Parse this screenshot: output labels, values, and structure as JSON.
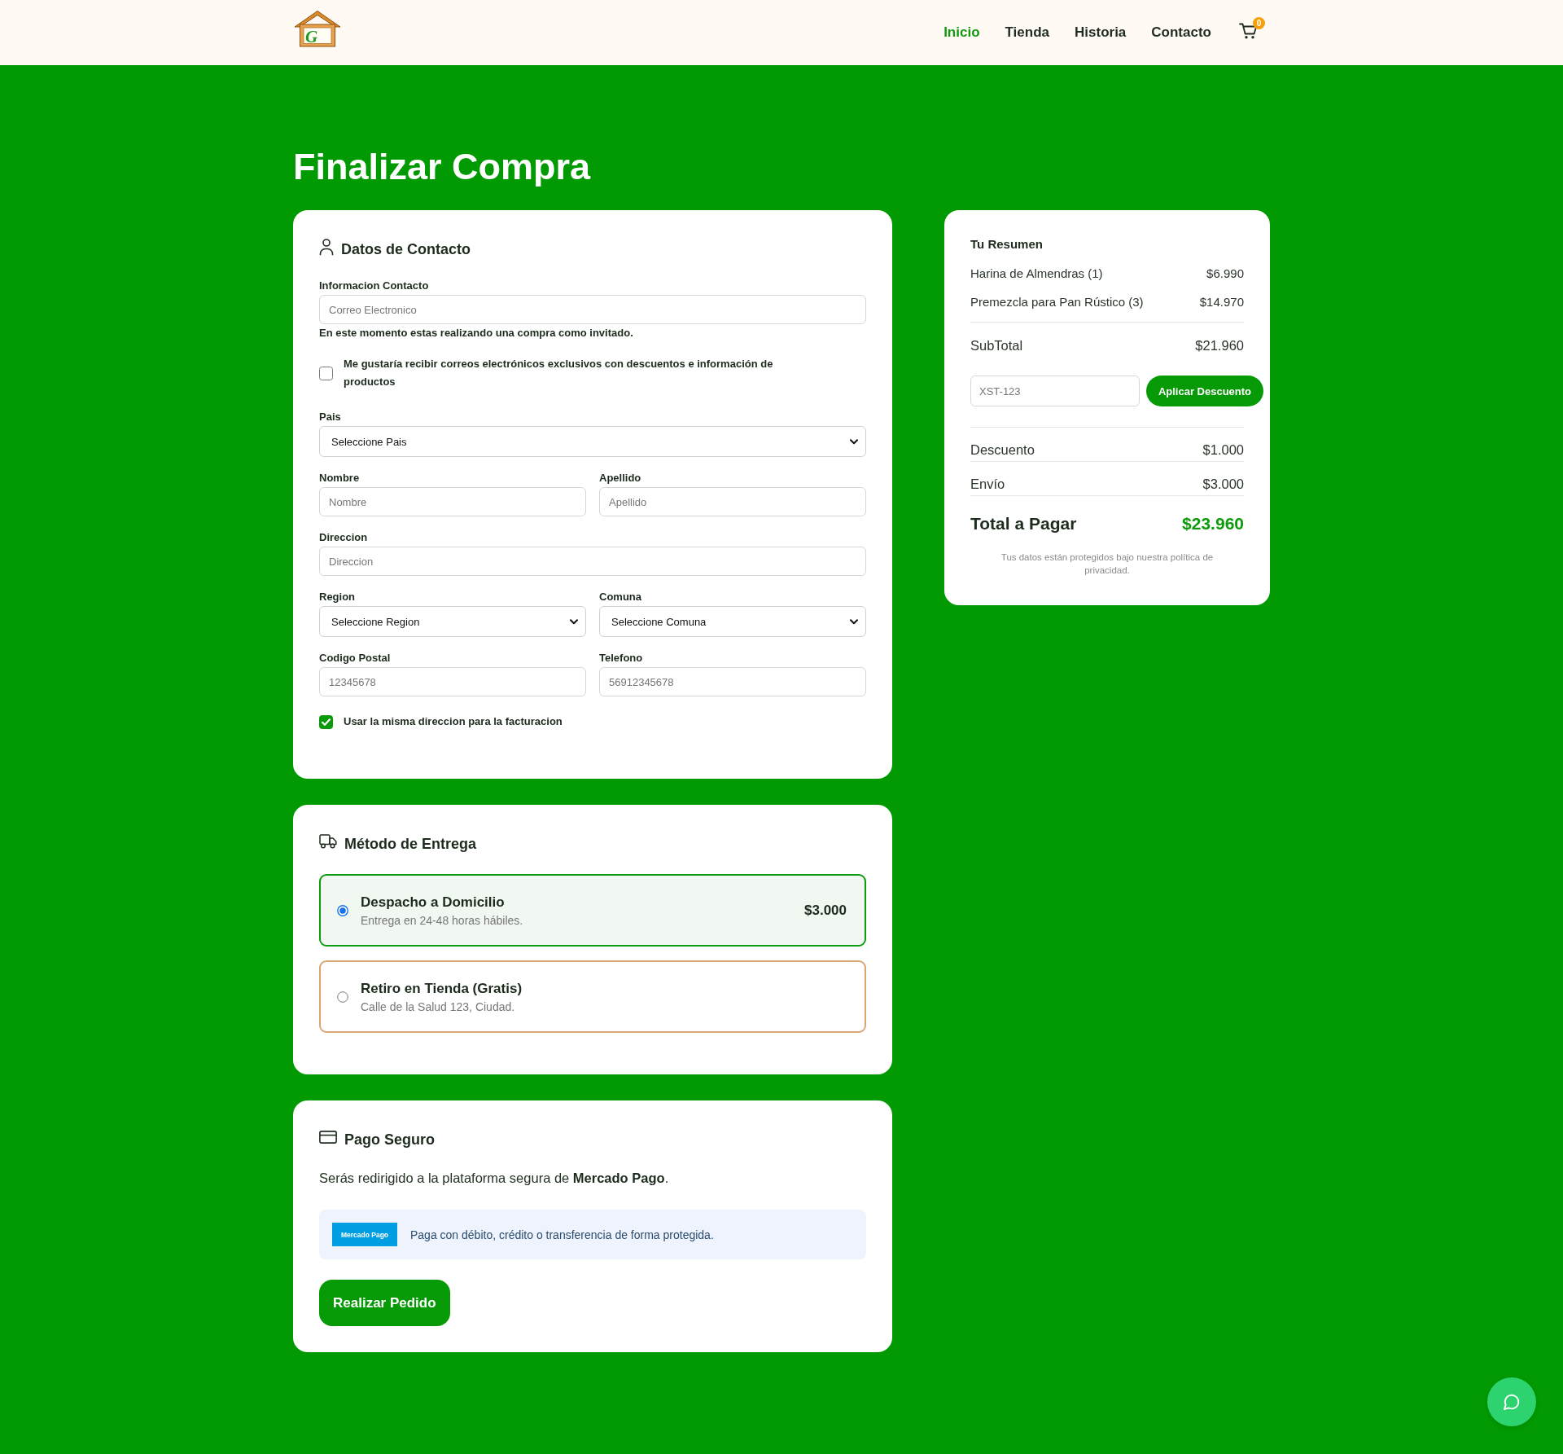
{
  "header": {
    "logo": {
      "initial": "G"
    },
    "nav": [
      {
        "label": "Inicio",
        "selected": true
      },
      {
        "label": "Tienda",
        "selected": false
      },
      {
        "label": "Historia",
        "selected": false
      },
      {
        "label": "Contacto",
        "selected": false
      }
    ],
    "cart": {
      "count": "0"
    }
  },
  "title": "Finalizar Compra",
  "contact": {
    "title": "Datos de Contacto",
    "email": {
      "label": "Informacion Contacto",
      "placeholder": "Correo Electronico"
    },
    "guest_note": "En este momento estas realizando una compra como invitado.",
    "newsletter": {
      "label": "Me gustaría recibir correos electrónicos exclusivos con descuentos e información de productos",
      "checked": false
    },
    "rows": [
      {
        "fields": [
          {
            "kind": "select",
            "label": "Pais",
            "value": "Seleccione Pais"
          }
        ]
      },
      {
        "fields": [
          {
            "kind": "input",
            "label": "Nombre",
            "placeholder": "Nombre"
          },
          {
            "kind": "input",
            "label": "Apellido",
            "placeholder": "Apellido"
          }
        ]
      },
      {
        "fields": [
          {
            "kind": "input",
            "label": "Direccion",
            "placeholder": "Direccion"
          }
        ]
      },
      {
        "fields": [
          {
            "kind": "select",
            "label": "Region",
            "value": "Seleccione Region"
          },
          {
            "kind": "select",
            "label": "Comuna",
            "value": "Seleccione Comuna"
          }
        ]
      },
      {
        "fields": [
          {
            "kind": "input",
            "label": "Codigo Postal",
            "placeholder": "12345678"
          },
          {
            "kind": "input",
            "label": "Telefono",
            "placeholder": "56912345678"
          }
        ]
      }
    ],
    "same_billing": {
      "label": "Usar la misma direccion para la facturacion",
      "checked": true
    }
  },
  "delivery": {
    "title": "Método de Entrega",
    "options": [
      {
        "title": "Despacho a Domicilio",
        "detail": "Entrega en 24-48 horas hábiles.",
        "price": "$3.000",
        "selected": true
      },
      {
        "title": "Retiro en Tienda (Gratis)",
        "detail": "Calle de la Salud 123, Ciudad.",
        "selected": false
      }
    ]
  },
  "payment": {
    "title": "Pago Seguro",
    "note": "Serás redirigido a la plataforma segura de **Mercado Pago**.",
    "provider": {
      "logo": "Mercado Pago",
      "text": "Paga con débito, crédito o transferencia de forma protegida."
    },
    "submit": "Realizar Pedido"
  },
  "summary": {
    "title": "Tu Resumen",
    "items": [
      {
        "name": "Harina de Almendras (1)",
        "price": "$6.990"
      },
      {
        "name": "Premezcla para Pan Rústico (3)",
        "price": "$14.970"
      }
    ],
    "subtotal": {
      "label": "SubTotal",
      "value": "$21.960"
    },
    "coupon": {
      "placeholder": "XST-123",
      "button": "Aplicar Descuento"
    },
    "lines": [
      {
        "label": "Descuento",
        "value": "$1.000"
      },
      {
        "label": "Envío",
        "value": "$3.000"
      }
    ],
    "total": {
      "label": "Total a Pagar",
      "value": "$23.960"
    },
    "footnote": "Tus datos están protegidos bajo nuestra política de privacidad."
  }
}
